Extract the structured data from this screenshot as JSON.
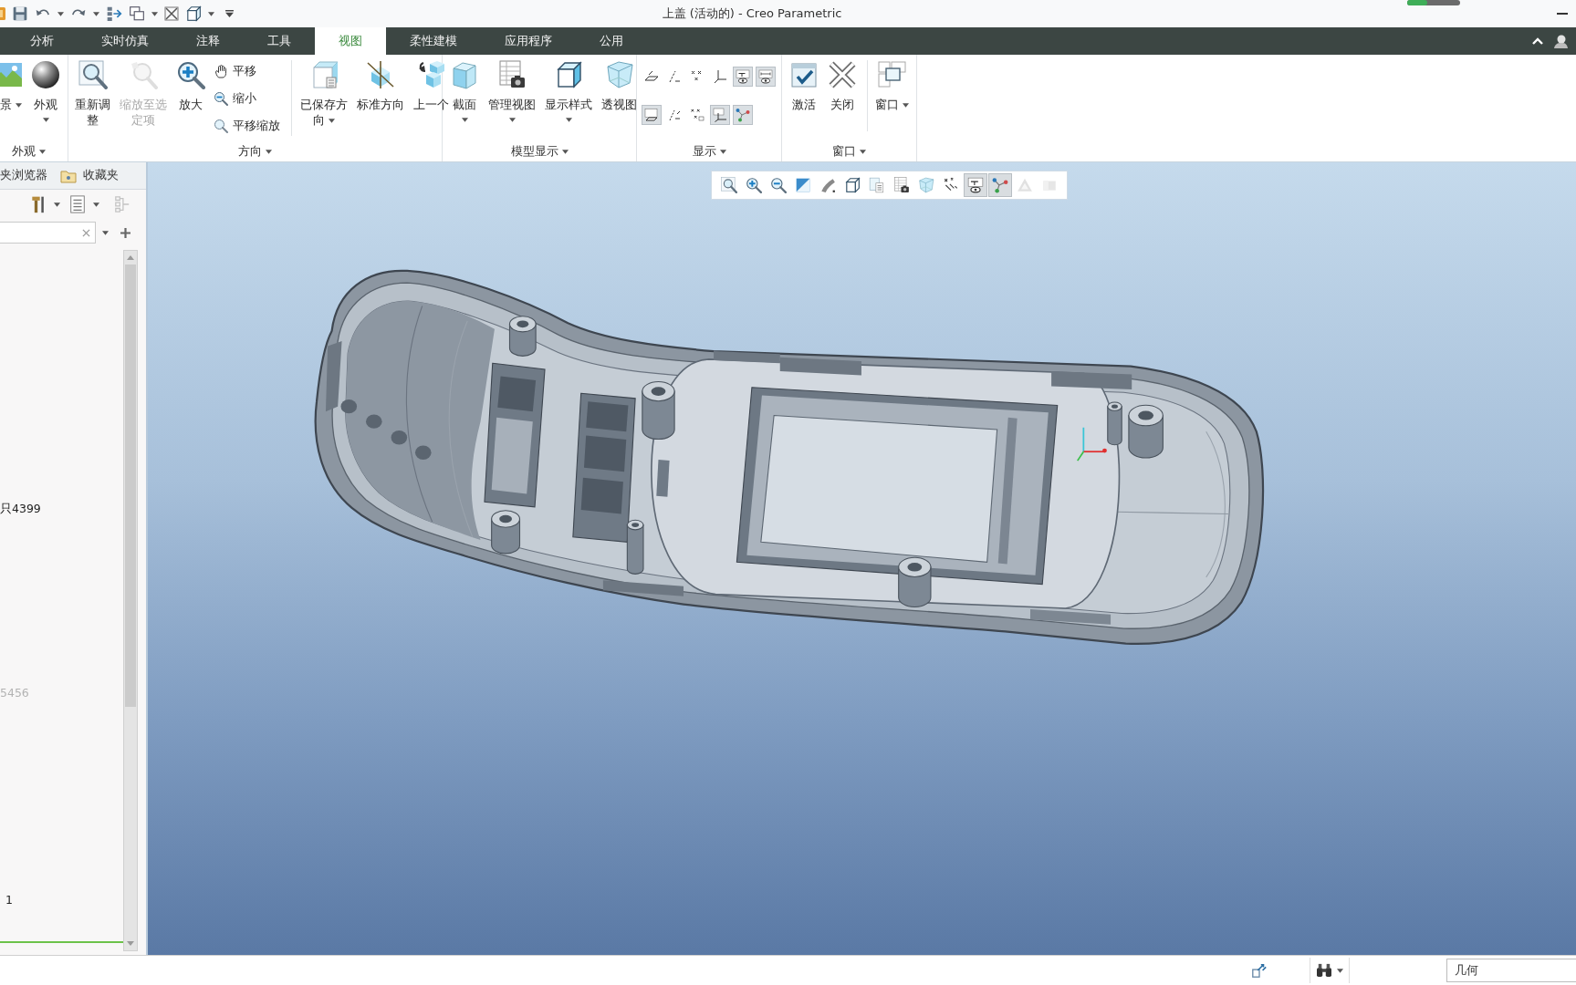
{
  "window": {
    "title": "上盖 (活动的) - Creo Parametric"
  },
  "tabs": [
    {
      "label": "分析",
      "selected": false
    },
    {
      "label": "实时仿真",
      "selected": false
    },
    {
      "label": "注释",
      "selected": false
    },
    {
      "label": "工具",
      "selected": false
    },
    {
      "label": "视图",
      "selected": true
    },
    {
      "label": "柔性建模",
      "selected": false
    },
    {
      "label": "应用程序",
      "selected": false
    },
    {
      "label": "公用",
      "selected": false
    }
  ],
  "ribbon": {
    "groups": [
      {
        "label": "外观",
        "items": [
          {
            "kind": "background",
            "label": "景",
            "menu": true,
            "disabled": false
          },
          {
            "kind": "appearance",
            "label": "外观",
            "menu": true,
            "disabled": false
          }
        ]
      },
      {
        "label": "方向",
        "items": [
          {
            "kind": "refit",
            "label": "重新调整",
            "menu": false,
            "disabled": false
          },
          {
            "kind": "zoom-selected",
            "label": "缩放至选定项",
            "menu": false,
            "disabled": true
          },
          {
            "kind": "zoom-in",
            "label": "放大",
            "menu": false,
            "disabled": false
          },
          {
            "kind": "stack",
            "items": [
              {
                "kind": "pan",
                "label": "平移",
                "disabled": false
              },
              {
                "kind": "zoom-out",
                "label": "缩小",
                "disabled": false
              },
              {
                "kind": "pan-zoom",
                "label": "平移缩放",
                "disabled": false
              }
            ]
          },
          {
            "kind": "saved-views",
            "label": "已保存方向",
            "menu": true,
            "disabled": false
          },
          {
            "kind": "standard-view",
            "label": "标准方向",
            "menu": false,
            "disabled": false
          },
          {
            "kind": "previous",
            "label": "上一个",
            "menu": false,
            "disabled": false
          }
        ]
      },
      {
        "label": "模型显示",
        "items": [
          {
            "kind": "section",
            "label": "截面",
            "menu": true,
            "disabled": false
          },
          {
            "kind": "view-manager",
            "label": "管理视图",
            "menu": true,
            "disabled": false
          },
          {
            "kind": "display-style",
            "label": "显示样式",
            "menu": true,
            "disabled": false
          },
          {
            "kind": "perspective",
            "label": "透视图",
            "menu": false,
            "disabled": false
          }
        ]
      },
      {
        "label": "显示",
        "toggle_rows": [
          [
            {
              "kind": "plane",
              "on": false
            },
            {
              "kind": "axis",
              "on": false
            },
            {
              "kind": "point",
              "on": false
            },
            {
              "kind": "csys",
              "on": false
            },
            {
              "kind": "annotation",
              "on": true
            },
            {
              "kind": "dimension",
              "on": true
            }
          ],
          [
            {
              "kind": "plane-tag",
              "on": true
            },
            {
              "kind": "axis-tag",
              "on": false
            },
            {
              "kind": "point-tag",
              "on": false
            },
            {
              "kind": "csys-tag",
              "on": true
            },
            {
              "kind": "spin",
              "on": true
            }
          ]
        ]
      },
      {
        "label": "窗口",
        "items": [
          {
            "kind": "activate",
            "label": "激活",
            "menu": false,
            "disabled": false
          },
          {
            "kind": "close",
            "label": "关闭",
            "menu": false,
            "disabled": false
          },
          {
            "kind": "windows",
            "label": "窗口",
            "menu": true,
            "disabled": false
          }
        ]
      }
    ]
  },
  "model_tree": {
    "tabs": [
      {
        "label": "夹浏览器",
        "selected": false
      },
      {
        "label": "收藏夹",
        "selected": false
      }
    ],
    "rows": [
      {
        "label": "只4399",
        "dimmed": false
      },
      {
        "label": "5456",
        "dimmed": true
      },
      {
        "label": "1",
        "dimmed": false
      }
    ]
  },
  "graphics_toolbar": {
    "buttons": [
      {
        "kind": "refit",
        "on": false,
        "disabled": false
      },
      {
        "kind": "zoom-in",
        "on": false,
        "disabled": false
      },
      {
        "kind": "zoom-out",
        "on": false,
        "disabled": false
      },
      {
        "kind": "repaint",
        "on": false,
        "disabled": false
      },
      {
        "kind": "shading",
        "on": false,
        "disabled": false
      },
      {
        "kind": "orientation",
        "on": false,
        "disabled": false
      },
      {
        "kind": "view-list",
        "on": false,
        "disabled": false
      },
      {
        "kind": "view-manager",
        "on": false,
        "disabled": false
      },
      {
        "kind": "perspective",
        "on": false,
        "disabled": false
      },
      {
        "kind": "datum-filter",
        "on": false,
        "disabled": false
      },
      {
        "kind": "annotation",
        "on": true,
        "disabled": false
      },
      {
        "kind": "spin",
        "on": true,
        "disabled": false
      },
      {
        "kind": "triangle",
        "on": false,
        "disabled": true
      },
      {
        "kind": "block",
        "on": false,
        "disabled": true
      }
    ]
  },
  "status_bar": {
    "filter": {
      "value": "几何"
    }
  }
}
